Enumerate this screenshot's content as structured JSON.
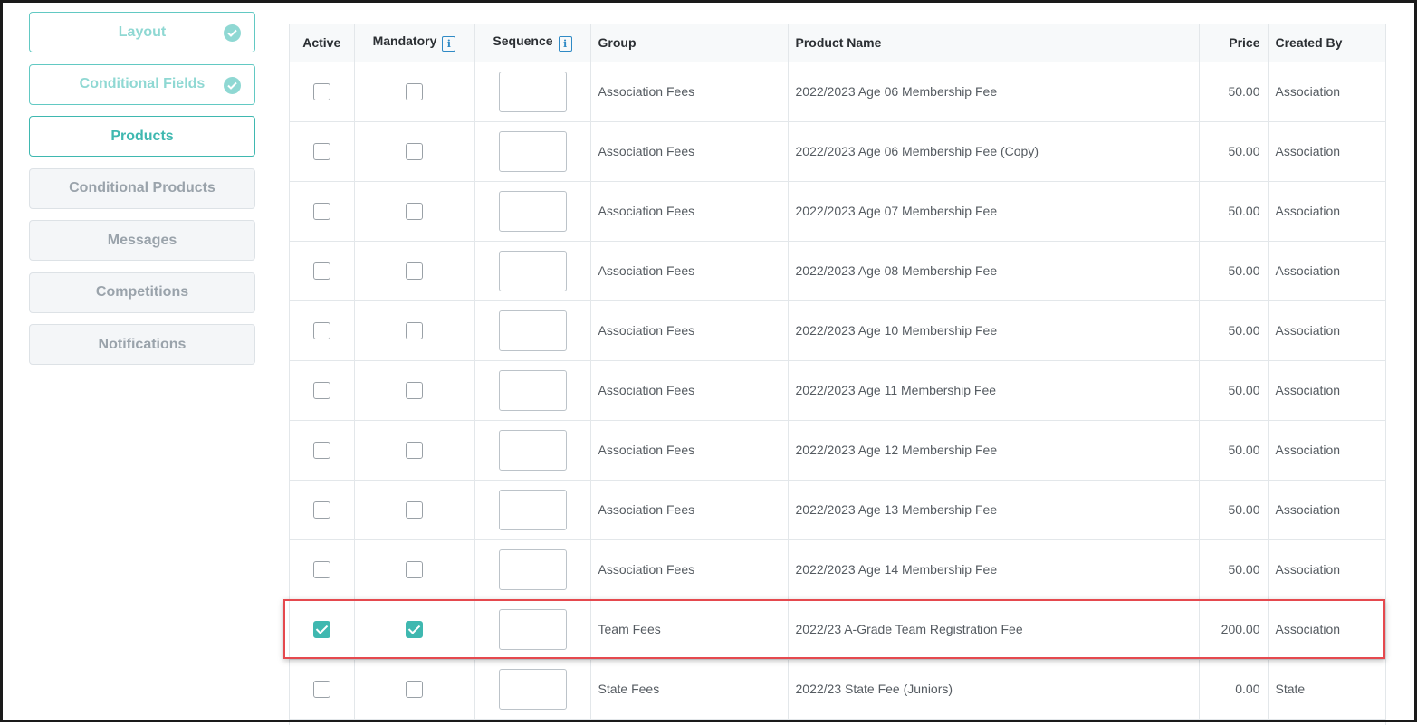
{
  "sidebar": {
    "items": [
      {
        "label": "Layout",
        "state": "done"
      },
      {
        "label": "Conditional Fields",
        "state": "done"
      },
      {
        "label": "Products",
        "state": "active"
      },
      {
        "label": "Conditional Products",
        "state": "todo"
      },
      {
        "label": "Messages",
        "state": "todo"
      },
      {
        "label": "Competitions",
        "state": "todo"
      },
      {
        "label": "Notifications",
        "state": "todo"
      }
    ]
  },
  "table": {
    "headers": {
      "active": "Active",
      "mandatory": "Mandatory",
      "sequence": "Sequence",
      "group": "Group",
      "product_name": "Product Name",
      "price": "Price",
      "created_by": "Created By"
    },
    "info_icon_glyph": "i",
    "rows": [
      {
        "active": false,
        "mandatory": false,
        "sequence": "",
        "group": "Association Fees",
        "product_name": "2022/2023 Age 06 Membership Fee",
        "price": "50.00",
        "created_by": "Association"
      },
      {
        "active": false,
        "mandatory": false,
        "sequence": "",
        "group": "Association Fees",
        "product_name": "2022/2023 Age 06 Membership Fee (Copy)",
        "price": "50.00",
        "created_by": "Association"
      },
      {
        "active": false,
        "mandatory": false,
        "sequence": "",
        "group": "Association Fees",
        "product_name": "2022/2023 Age 07 Membership Fee",
        "price": "50.00",
        "created_by": "Association"
      },
      {
        "active": false,
        "mandatory": false,
        "sequence": "",
        "group": "Association Fees",
        "product_name": "2022/2023 Age 08 Membership Fee",
        "price": "50.00",
        "created_by": "Association"
      },
      {
        "active": false,
        "mandatory": false,
        "sequence": "",
        "group": "Association Fees",
        "product_name": "2022/2023 Age 10 Membership Fee",
        "price": "50.00",
        "created_by": "Association"
      },
      {
        "active": false,
        "mandatory": false,
        "sequence": "",
        "group": "Association Fees",
        "product_name": "2022/2023 Age 11 Membership Fee",
        "price": "50.00",
        "created_by": "Association"
      },
      {
        "active": false,
        "mandatory": false,
        "sequence": "",
        "group": "Association Fees",
        "product_name": "2022/2023 Age 12 Membership Fee",
        "price": "50.00",
        "created_by": "Association"
      },
      {
        "active": false,
        "mandatory": false,
        "sequence": "",
        "group": "Association Fees",
        "product_name": "2022/2023 Age 13 Membership Fee",
        "price": "50.00",
        "created_by": "Association"
      },
      {
        "active": false,
        "mandatory": false,
        "sequence": "",
        "group": "Association Fees",
        "product_name": "2022/2023 Age 14 Membership Fee",
        "price": "50.00",
        "created_by": "Association"
      },
      {
        "active": true,
        "mandatory": true,
        "sequence": "",
        "group": "Team Fees",
        "product_name": "2022/23 A-Grade Team Registration Fee",
        "price": "200.00",
        "created_by": "Association",
        "highlighted": true
      },
      {
        "active": false,
        "mandatory": false,
        "sequence": "",
        "group": "State Fees",
        "product_name": "2022/23 State Fee (Juniors)",
        "price": "0.00",
        "created_by": "State"
      }
    ]
  },
  "colors": {
    "accent": "#3fb8b0",
    "highlight_border": "#e5494e",
    "info_icon": "#2f8ac5"
  }
}
